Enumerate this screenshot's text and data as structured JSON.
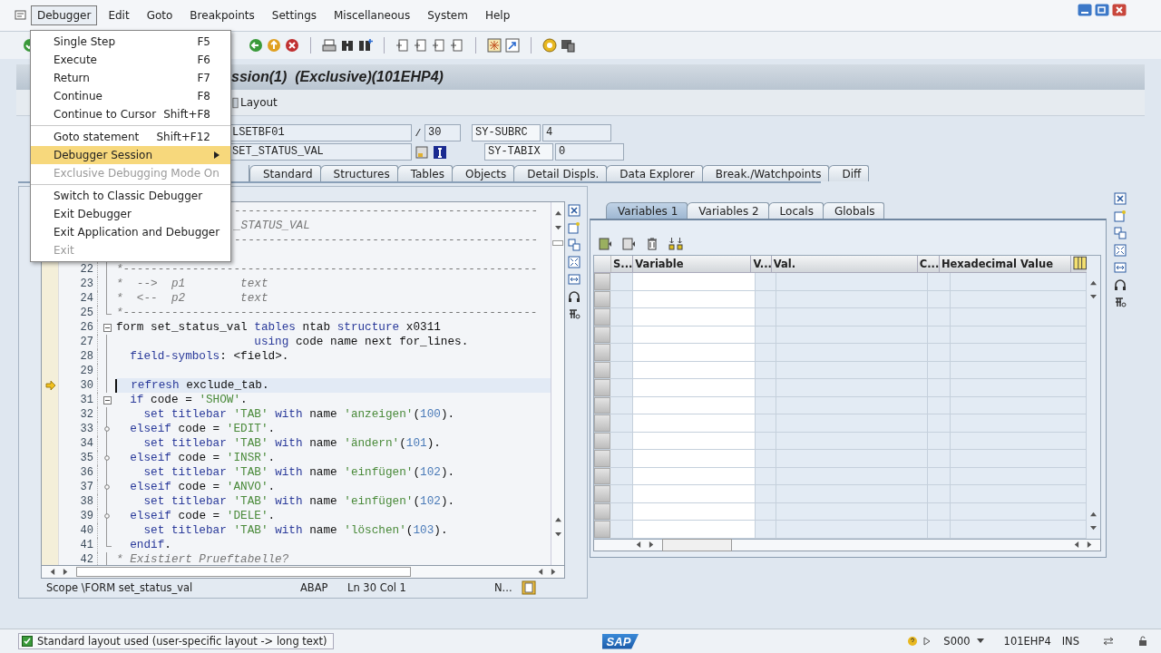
{
  "menubar": {
    "items": [
      {
        "label": "Debugger",
        "selected": true
      },
      {
        "label": "Edit",
        "selected": false
      },
      {
        "label": "Goto",
        "selected": false
      },
      {
        "label": "Breakpoints",
        "selected": false
      },
      {
        "label": "Settings",
        "selected": false
      },
      {
        "label": "Miscellaneous",
        "selected": false
      },
      {
        "label": "System",
        "selected": false
      },
      {
        "label": "Help",
        "selected": false
      }
    ]
  },
  "menu": {
    "groups": [
      [
        {
          "label": "Single Step",
          "shortcut": "F5",
          "selected": false,
          "disabled": false,
          "submenu": false
        },
        {
          "label": "Execute",
          "shortcut": "F6",
          "selected": false,
          "disabled": false,
          "submenu": false
        },
        {
          "label": "Return",
          "shortcut": "F7",
          "selected": false,
          "disabled": false,
          "submenu": false
        },
        {
          "label": "Continue",
          "shortcut": "F8",
          "selected": false,
          "disabled": false,
          "submenu": false
        },
        {
          "label": "Continue to Cursor",
          "shortcut": "Shift+F8",
          "selected": false,
          "disabled": false,
          "submenu": false
        }
      ],
      [
        {
          "label": "Goto statement",
          "shortcut": "Shift+F12",
          "selected": false,
          "disabled": false,
          "submenu": false
        },
        {
          "label": "Debugger Session",
          "selected": true,
          "disabled": false,
          "submenu": true
        },
        {
          "label": "Exclusive Debugging Mode On",
          "selected": false,
          "disabled": true,
          "submenu": false
        }
      ],
      [
        {
          "label": "Switch to Classic Debugger",
          "selected": false,
          "disabled": false,
          "submenu": false
        },
        {
          "label": "Exit Debugger",
          "selected": false,
          "disabled": false,
          "submenu": false
        },
        {
          "label": "Exit Application and Debugger",
          "selected": false,
          "disabled": false,
          "submenu": false
        },
        {
          "label": "Exit",
          "selected": false,
          "disabled": true,
          "submenu": false
        }
      ]
    ]
  },
  "title": "ssion(1)  (Exclusive)(101EHP4)",
  "app_toolbar": {
    "button": "Layout"
  },
  "fields": {
    "program": "LSETBF01",
    "slash": "/",
    "line": "30",
    "subrc_label": "SY-SUBRC",
    "subrc": "4",
    "routine": "SET_STATUS_VAL",
    "tabix_label": "SY-TABIX",
    "tabix": "0"
  },
  "tabs": [
    {
      "label": "Standard",
      "selected": false
    },
    {
      "label": "Structures",
      "selected": false
    },
    {
      "label": "Tables",
      "selected": false
    },
    {
      "label": "Objects",
      "selected": false
    },
    {
      "label": "Detail Displs.",
      "selected": false
    },
    {
      "label": "Data Explorer",
      "selected": false
    },
    {
      "label": "Break./Watchpoints",
      "selected": false
    },
    {
      "label": "Diff",
      "selected": false
    }
  ],
  "code": {
    "lines": [
      {
        "kind": "partial",
        "current": false,
        "tokens": [
          {
            "kind": "comment",
            "text": "--------------------------------------------"
          }
        ]
      },
      {
        "kind": "partial",
        "current": false,
        "tokens": [
          {
            "kind": "comment",
            "text": "_STATUS_VAL"
          }
        ]
      },
      {
        "kind": "partial",
        "current": false,
        "tokens": [
          {
            "kind": "comment",
            "text": "--------------------------------------------"
          }
        ]
      },
      {
        "kind": "blank",
        "current": false
      },
      {
        "kind": "code",
        "number": "22",
        "fold": {
          "kind": "line"
        },
        "current": false,
        "tokens": [
          {
            "kind": "comment",
            "text": "*------------------------------------------------------------"
          }
        ]
      },
      {
        "kind": "code",
        "number": "23",
        "fold": {
          "kind": "line"
        },
        "current": false,
        "tokens": [
          {
            "kind": "comment",
            "text": "*  -->  p1        text"
          }
        ]
      },
      {
        "kind": "code",
        "number": "24",
        "fold": {
          "kind": "line"
        },
        "current": false,
        "tokens": [
          {
            "kind": "comment",
            "text": "*  <--  p2        text"
          }
        ]
      },
      {
        "kind": "code",
        "number": "25",
        "fold": {
          "kind": "end"
        },
        "current": false,
        "tokens": [
          {
            "kind": "comment",
            "text": "*------------------------------------------------------------"
          }
        ]
      },
      {
        "kind": "code",
        "number": "26",
        "fold": {
          "kind": "open"
        },
        "current": false,
        "tokens": [
          {
            "kind": "plain",
            "text": "form set_status_val "
          },
          {
            "kind": "keyword",
            "text": "tables"
          },
          {
            "kind": "plain",
            "text": " ntab "
          },
          {
            "kind": "keyword",
            "text": "structure"
          },
          {
            "kind": "plain",
            "text": " x0311"
          }
        ]
      },
      {
        "kind": "code",
        "number": "27",
        "fold": {
          "kind": "line"
        },
        "current": false,
        "tokens": [
          {
            "kind": "keyword",
            "text": "                    using"
          },
          {
            "kind": "plain",
            "text": " code name next for_lines."
          }
        ]
      },
      {
        "kind": "code",
        "number": "28",
        "fold": {
          "kind": "line"
        },
        "current": false,
        "tokens": [
          {
            "kind": "keyword",
            "text": "  field-symbols"
          },
          {
            "kind": "plain",
            "text": ": <field>."
          }
        ]
      },
      {
        "kind": "blank",
        "number": "29",
        "fold": {
          "kind": "line"
        },
        "current": false
      },
      {
        "kind": "code",
        "number": "30",
        "fold": {
          "kind": "line"
        },
        "current": true,
        "tokens": [
          {
            "kind": "keyword",
            "text": "  refresh"
          },
          {
            "kind": "plain",
            "text": " exclude_tab."
          }
        ]
      },
      {
        "kind": "code",
        "number": "31",
        "fold": {
          "kind": "open"
        },
        "current": false,
        "tokens": [
          {
            "kind": "keyword",
            "text": "  if"
          },
          {
            "kind": "plain",
            "text": " code = "
          },
          {
            "kind": "string",
            "text": "'SHOW'"
          },
          {
            "kind": "plain",
            "text": "."
          }
        ]
      },
      {
        "kind": "code",
        "number": "32",
        "fold": {
          "kind": "line"
        },
        "current": false,
        "tokens": [
          {
            "kind": "keyword",
            "text": "    set titlebar "
          },
          {
            "kind": "string",
            "text": "'TAB'"
          },
          {
            "kind": "keyword",
            "text": " with"
          },
          {
            "kind": "plain",
            "text": " name "
          },
          {
            "kind": "string",
            "text": "'anzeigen'"
          },
          {
            "kind": "plain",
            "text": "("
          },
          {
            "kind": "number",
            "text": "100"
          },
          {
            "kind": "plain",
            "text": ")."
          }
        ]
      },
      {
        "kind": "code",
        "number": "33",
        "fold": {
          "kind": "branch"
        },
        "current": false,
        "tokens": [
          {
            "kind": "keyword",
            "text": "  elseif"
          },
          {
            "kind": "plain",
            "text": " code = "
          },
          {
            "kind": "string",
            "text": "'EDIT'"
          },
          {
            "kind": "plain",
            "text": "."
          }
        ]
      },
      {
        "kind": "code",
        "number": "34",
        "fold": {
          "kind": "line"
        },
        "current": false,
        "tokens": [
          {
            "kind": "keyword",
            "text": "    set titlebar "
          },
          {
            "kind": "string",
            "text": "'TAB'"
          },
          {
            "kind": "keyword",
            "text": " with"
          },
          {
            "kind": "plain",
            "text": " name "
          },
          {
            "kind": "string",
            "text": "'ändern'"
          },
          {
            "kind": "plain",
            "text": "("
          },
          {
            "kind": "number",
            "text": "101"
          },
          {
            "kind": "plain",
            "text": ")."
          }
        ]
      },
      {
        "kind": "code",
        "number": "35",
        "fold": {
          "kind": "branch"
        },
        "current": false,
        "tokens": [
          {
            "kind": "keyword",
            "text": "  elseif"
          },
          {
            "kind": "plain",
            "text": " code = "
          },
          {
            "kind": "string",
            "text": "'INSR'"
          },
          {
            "kind": "plain",
            "text": "."
          }
        ]
      },
      {
        "kind": "code",
        "number": "36",
        "fold": {
          "kind": "line"
        },
        "current": false,
        "tokens": [
          {
            "kind": "keyword",
            "text": "    set titlebar "
          },
          {
            "kind": "string",
            "text": "'TAB'"
          },
          {
            "kind": "keyword",
            "text": " with"
          },
          {
            "kind": "plain",
            "text": " name "
          },
          {
            "kind": "string",
            "text": "'einfügen'"
          },
          {
            "kind": "plain",
            "text": "("
          },
          {
            "kind": "number",
            "text": "102"
          },
          {
            "kind": "plain",
            "text": ")."
          }
        ]
      },
      {
        "kind": "code",
        "number": "37",
        "fold": {
          "kind": "branch"
        },
        "current": false,
        "tokens": [
          {
            "kind": "keyword",
            "text": "  elseif"
          },
          {
            "kind": "plain",
            "text": " code = "
          },
          {
            "kind": "string",
            "text": "'ANVO'"
          },
          {
            "kind": "plain",
            "text": "."
          }
        ]
      },
      {
        "kind": "code",
        "number": "38",
        "fold": {
          "kind": "line"
        },
        "current": false,
        "tokens": [
          {
            "kind": "keyword",
            "text": "    set titlebar "
          },
          {
            "kind": "string",
            "text": "'TAB'"
          },
          {
            "kind": "keyword",
            "text": " with"
          },
          {
            "kind": "plain",
            "text": " name "
          },
          {
            "kind": "string",
            "text": "'einfügen'"
          },
          {
            "kind": "plain",
            "text": "("
          },
          {
            "kind": "number",
            "text": "102"
          },
          {
            "kind": "plain",
            "text": ")."
          }
        ]
      },
      {
        "kind": "code",
        "number": "39",
        "fold": {
          "kind": "branch"
        },
        "current": false,
        "tokens": [
          {
            "kind": "keyword",
            "text": "  elseif"
          },
          {
            "kind": "plain",
            "text": " code = "
          },
          {
            "kind": "string",
            "text": "'DELE'"
          },
          {
            "kind": "plain",
            "text": "."
          }
        ]
      },
      {
        "kind": "code",
        "number": "40",
        "fold": {
          "kind": "line"
        },
        "current": false,
        "tokens": [
          {
            "kind": "keyword",
            "text": "    set titlebar "
          },
          {
            "kind": "string",
            "text": "'TAB'"
          },
          {
            "kind": "keyword",
            "text": " with"
          },
          {
            "kind": "plain",
            "text": " name "
          },
          {
            "kind": "string",
            "text": "'löschen'"
          },
          {
            "kind": "plain",
            "text": "("
          },
          {
            "kind": "number",
            "text": "103"
          },
          {
            "kind": "plain",
            "text": ")."
          }
        ]
      },
      {
        "kind": "code",
        "number": "41",
        "fold": {
          "kind": "end"
        },
        "current": false,
        "tokens": [
          {
            "kind": "keyword",
            "text": "  endif"
          },
          {
            "kind": "plain",
            "text": "."
          }
        ]
      },
      {
        "kind": "code",
        "number": "42",
        "fold": {
          "kind": "line"
        },
        "current": false,
        "tokens": [
          {
            "kind": "comment",
            "text": "* Existiert Prueftabelle?"
          }
        ]
      }
    ],
    "status": {
      "scope": "Scope \\FORM set_status_val",
      "language": "ABAP",
      "position": "Ln 30 Col 1",
      "mode": "N..."
    }
  },
  "variables": {
    "tabs": [
      {
        "label": "Variables 1",
        "selected": true
      },
      {
        "label": "Variables 2",
        "selected": false
      },
      {
        "label": "Locals",
        "selected": false
      },
      {
        "label": "Globals",
        "selected": false
      }
    ],
    "columns": [
      "S...",
      "Variable",
      "V...",
      "Val.",
      "C...",
      "Hexadecimal Value"
    ]
  },
  "status_bar": {
    "message": "Standard layout used (user-specific layout -> long text)",
    "logo": "SAP",
    "system": "S000",
    "server": "101EHP4",
    "mode": "INS"
  }
}
